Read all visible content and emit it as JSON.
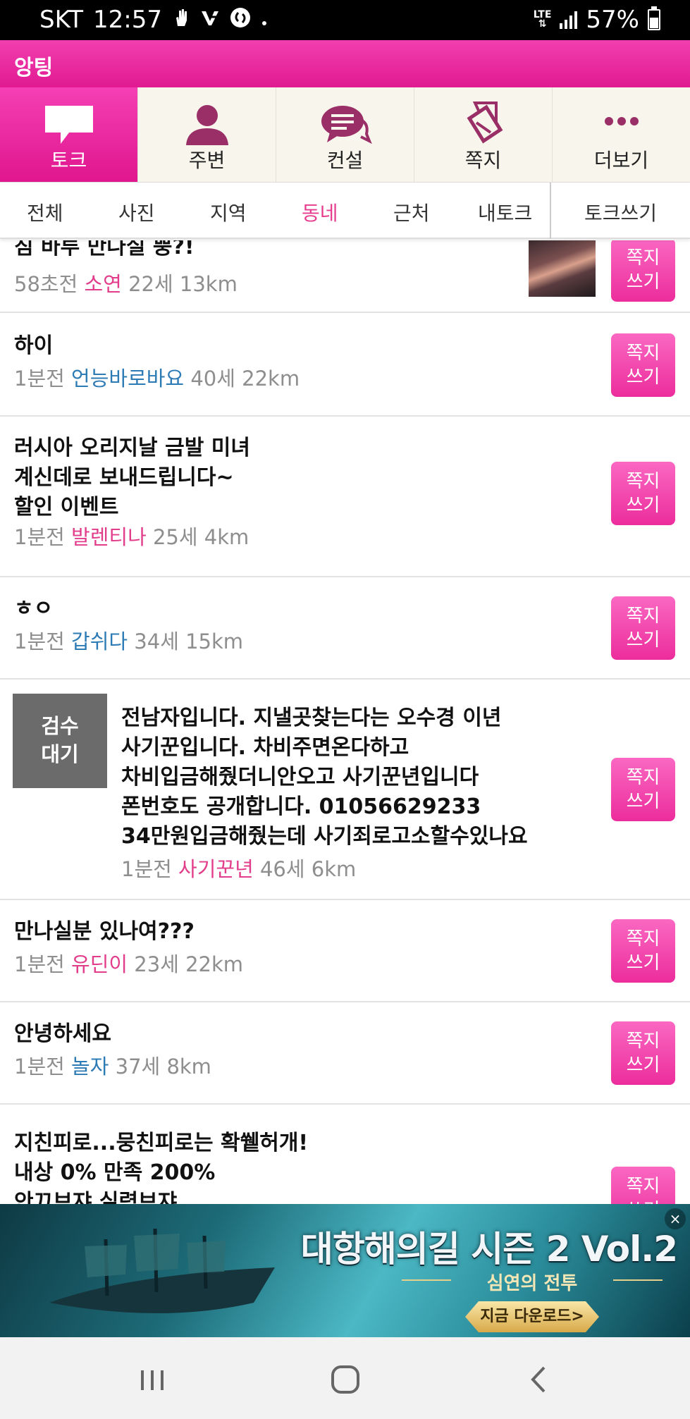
{
  "status_bar": {
    "carrier": "SKT",
    "time": "12:57",
    "notification_icons": [
      "hand-icon",
      "vk-icon",
      "shazam-icon",
      "dot-icon"
    ],
    "network": "LTE",
    "battery": "57%",
    "battery_level": 0.57
  },
  "app": {
    "title": "앙팅",
    "brand_color": "#e8248f"
  },
  "main_tabs": [
    {
      "label": "토크",
      "icon": "chat-bubble-icon",
      "active": true
    },
    {
      "label": "주변",
      "icon": "person-icon",
      "active": false
    },
    {
      "label": "컨설",
      "icon": "consult-bubble-icon",
      "active": false
    },
    {
      "label": "쪽지",
      "icon": "note-icon",
      "active": false
    },
    {
      "label": "더보기",
      "icon": "more-dots-icon",
      "active": false
    }
  ],
  "sub_tabs": [
    "전체",
    "사진",
    "지역",
    "동네",
    "근처",
    "내토크"
  ],
  "active_sub_tab": "동네",
  "write_button": "토크쓰기",
  "message_button": {
    "line1": "쪽지",
    "line2": "쓰기"
  },
  "posts": [
    {
      "lines": [
        "짐 바루 만나실 뿡?!"
      ],
      "time": "58초전",
      "nick": "소연",
      "nick_color": "pink",
      "age": "22세",
      "distance": "13km",
      "has_photo": true
    },
    {
      "lines": [
        "하이"
      ],
      "time": "1분전",
      "nick": "언능바로바요",
      "nick_color": "blue",
      "age": "40세",
      "distance": "22km"
    },
    {
      "lines": [
        "러시아 오리지날 금발 미녀",
        "계신데로 보내드립니다~",
        "할인 이벤트"
      ],
      "time": "1분전",
      "nick": "발렌티나",
      "nick_color": "pink",
      "age": "25세",
      "distance": "4km"
    },
    {
      "lines": [
        "ㅎㅇ"
      ],
      "time": "1분전",
      "nick": "갑쉬다",
      "nick_color": "blue",
      "age": "34세",
      "distance": "15km"
    },
    {
      "lines": [
        "전남자입니다.   지낼곳찾는다는 오수경 이년",
        "사기꾼입니다.  차비주면온다하고",
        "차비입금해줬더니안오고 사기꾼년입니다",
        "폰번호도 공개합니다. 01056629233",
        "34만원입금해줬는데  사기죄로고소할수있나요"
      ],
      "time": "1분전",
      "nick": "사기꾼년",
      "nick_color": "pink",
      "age": "46세",
      "distance": "6km",
      "pending_label": [
        "검수",
        "대기"
      ]
    },
    {
      "lines": [
        "만나실분 있나여???"
      ],
      "time": "1분전",
      "nick": "유딘이",
      "nick_color": "pink",
      "age": "23세",
      "distance": "22km"
    },
    {
      "lines": [
        "안녕하세요"
      ],
      "time": "1분전",
      "nick": "놀자",
      "nick_color": "blue",
      "age": "37세",
      "distance": "8km"
    },
    {
      "lines": [
        "지친피로...뭉친피로는 확쒵허개!",
        "내상 0% 만족 200%",
        "안끄브쟈 실력브쟈"
      ],
      "time": "",
      "nick": "",
      "age": "",
      "distance": ""
    }
  ],
  "ad": {
    "title": "대항해의길 시즌 2 Vol.2",
    "subtitle": "심연의 전투",
    "cta": "지금 다운로드>",
    "close": "×"
  },
  "nav_bar": [
    "recent-apps-icon",
    "home-icon",
    "back-icon"
  ]
}
